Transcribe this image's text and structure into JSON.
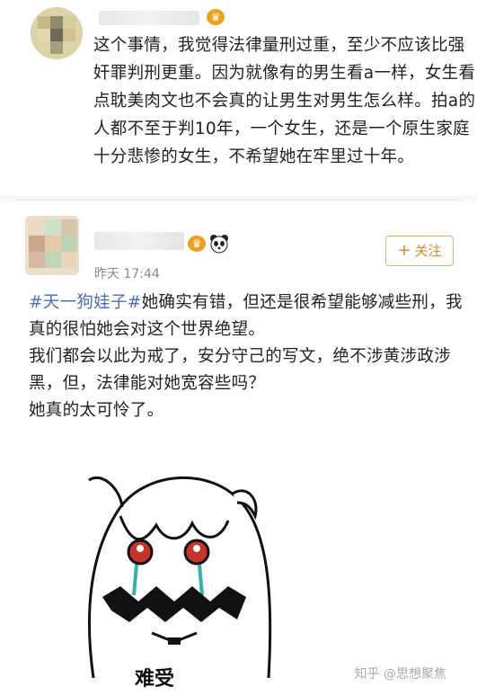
{
  "post1": {
    "text": "这个事情，我觉得法律量刑过重，至少不应该比强奸罪判刑更重。因为就像有的男生看a一样，女生看点耽美肉文也不会真的让男生对男生怎么样。拍a的人都不至于判10年，一个女生，还是一个原生家庭十分悲惨的女生，不希望她在牢里过十年。"
  },
  "post2": {
    "time": "昨天 17:44",
    "follow_label": "关注",
    "topic": "#天一狗娃子#",
    "line1_rest": "她确实有错，但还是很希望能够减些刑，我真的很怕她会对这个世界绝望。",
    "line2": "我们都会以此为戒了，安分守己的写文，绝不涉黄涉政涉黑，但，法律能对她宽容些吗？",
    "line3": "她真的太可怜了。",
    "sticker_caption": "难受"
  },
  "watermark": "知乎 @思想聚焦",
  "colors": {
    "topic": "#4a6fb8",
    "follow": "#e08a2c",
    "crown": "#f0a020"
  },
  "icons": [
    "crown-icon",
    "panda-icon",
    "plus-icon",
    "crying-anime-girl-sticker"
  ]
}
